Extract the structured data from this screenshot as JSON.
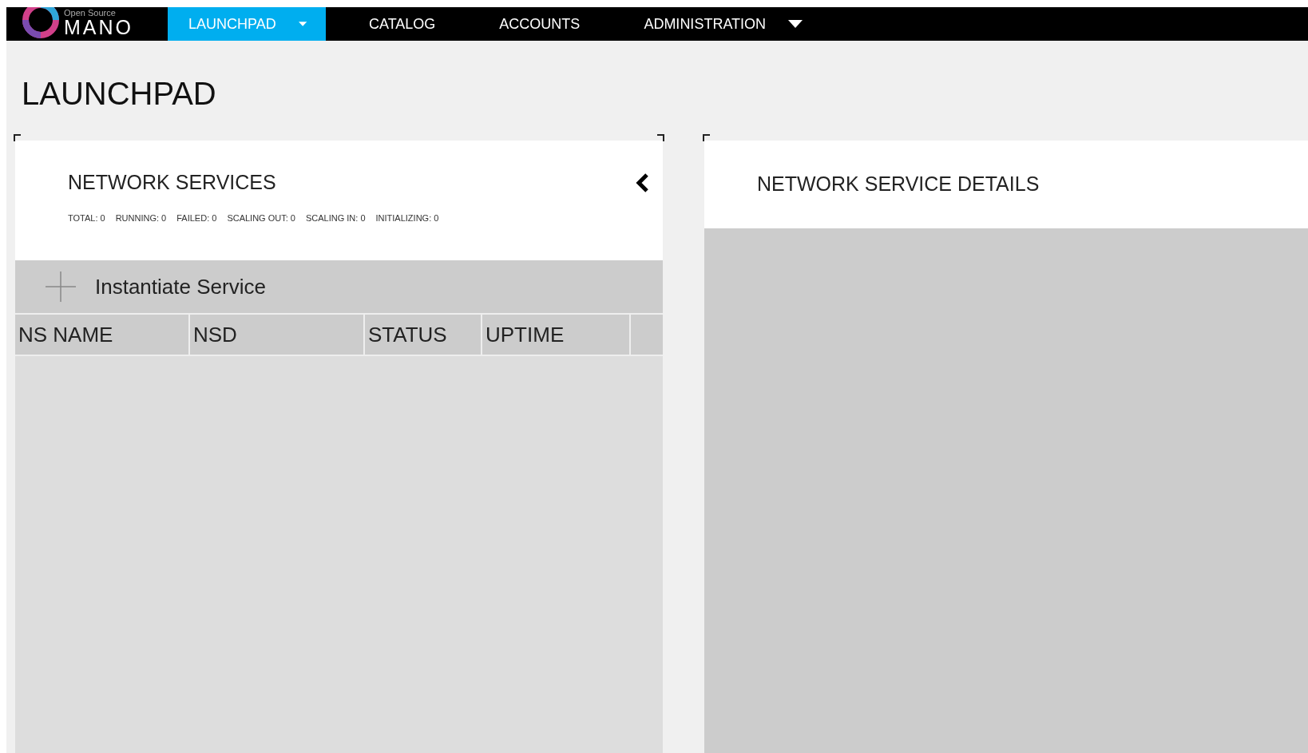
{
  "logo": {
    "tagline": "Open Source",
    "name": "MANO"
  },
  "nav": [
    {
      "label": "LAUNCHPAD",
      "selected": true,
      "has_menu": true
    },
    {
      "label": "CATALOG",
      "selected": false,
      "has_menu": false
    },
    {
      "label": "ACCOUNTS",
      "selected": false,
      "has_menu": false
    },
    {
      "label": "ADMINISTRATION",
      "selected": false,
      "has_menu": true
    }
  ],
  "page_title": "LAUNCHPAD",
  "services_panel": {
    "title": "NETWORK SERVICES",
    "stats": [
      "TOTAL: 0",
      "RUNNING: 0",
      "FAILED: 0",
      "SCALING OUT: 0",
      "SCALING IN: 0",
      "INITIALIZING: 0"
    ],
    "action": "Instantiate Service",
    "columns": [
      "NS NAME",
      "NSD",
      "STATUS",
      "UPTIME"
    ]
  },
  "details_panel": {
    "title": "NETWORK SERVICE DETAILS"
  }
}
